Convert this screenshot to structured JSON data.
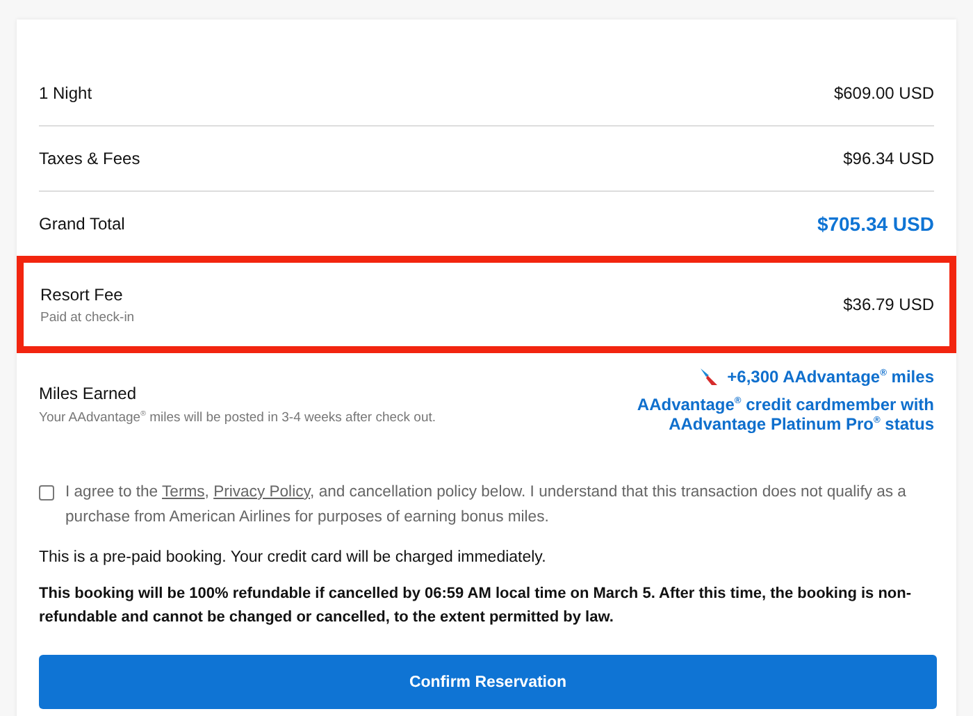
{
  "price_rows": [
    {
      "kind": "line",
      "label": "1 Night",
      "amount": "$609.00 USD"
    },
    {
      "kind": "line",
      "label": "Taxes & Fees",
      "amount": "$96.34 USD"
    },
    {
      "kind": "total",
      "label": "Grand Total",
      "amount": "$705.34 USD"
    },
    {
      "kind": "highlight",
      "label": "Resort Fee",
      "note": "Paid at check-in",
      "amount": "$36.79 USD"
    }
  ],
  "miles": {
    "label": "Miles Earned",
    "note": "Your AAdvantage$^{®}$ miles will be posted in 3-4 weeks after check out.",
    "earned": "+6,300 AAdvantage$^{®}$ miles",
    "status": "AAdvantage$^{®}$ credit cardmember with AAdvantage Platinum Pro$^{®}$ status"
  },
  "agreement": {
    "checked": false,
    "parts": [
      {
        "kind": "text",
        "text": "I agree to the "
      },
      {
        "kind": "link",
        "text": "Terms"
      },
      {
        "kind": "text",
        "text": ", "
      },
      {
        "kind": "link",
        "text": "Privacy Policy"
      },
      {
        "kind": "text",
        "text": ", and cancellation policy below.  I understand that this transaction does not qualify as a purchase from American Airlines for purposes of earning bonus miles."
      }
    ]
  },
  "prepaid_note": "This is a pre-paid booking. Your credit card will be charged immediately.",
  "refund_note": "This booking will be 100% refundable if cancelled by 06:59 AM local time on March 5. After this time, the booking is non-refundable and cannot be changed or cancelled, to the extent permitted by law.",
  "confirm_button": "Confirm Reservation"
}
